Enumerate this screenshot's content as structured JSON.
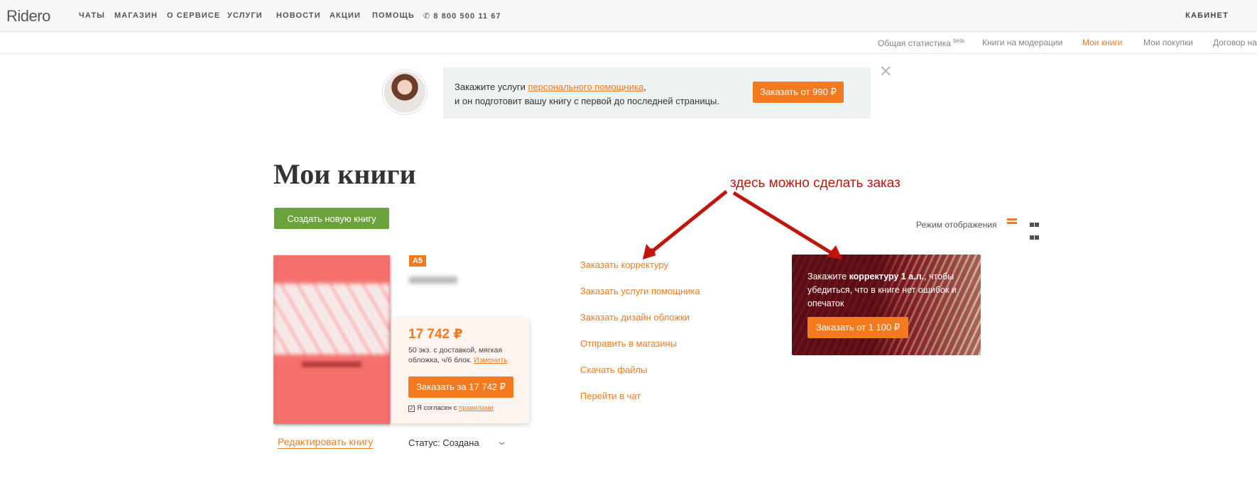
{
  "header": {
    "logo": "Ridero",
    "nav": [
      "ЧАТЫ",
      "МАГАЗИН",
      "О СЕРВИСЕ",
      "УСЛУГИ",
      "НОВОСТИ",
      "АКЦИИ",
      "ПОМОЩЬ"
    ],
    "phone": "8 800 500 11 67",
    "cabinet": "КАБИНЕТ"
  },
  "subnav": {
    "items": [
      {
        "label": "Общая статистика",
        "sup": "beta"
      },
      {
        "label": "Книги на модерации"
      },
      {
        "label": "Мои книги",
        "active": true
      },
      {
        "label": "Мои покупки"
      },
      {
        "label": "Договор на"
      }
    ]
  },
  "promo": {
    "text_before": "Закажите услуги ",
    "link": "персонального помощника",
    "text_after": ",",
    "line2": "и он подготовит вашу книгу с первой до последней страницы.",
    "button": "Заказать от 990 ₽"
  },
  "page": {
    "title": "Мои книги",
    "annotation": "здесь можно сделать заказ",
    "create_button": "Создать новую книгу",
    "view_mode_label": "Режим отображения"
  },
  "book": {
    "format": "A5",
    "price": "17 742 ₽",
    "desc": "50 экз. с доставкой, мягкая обложка, ч/б блок.",
    "change_link": "Изменить",
    "order_button": "Заказать за 17 742 ₽",
    "agree_text": "Я согласен с",
    "agree_link": "правилами",
    "edit_link": "Редактировать книгу",
    "status": "Статус: Создана"
  },
  "actions": [
    "Заказать корректуру",
    "Заказать услуги помощника",
    "Заказать дизайн обложки",
    "Отправить в магазины",
    "Скачать файлы",
    "Перейти в чат"
  ],
  "ad": {
    "text_before": "Закажите ",
    "bold": "корректуру 1 а.л.",
    "text_after": ", чтобы убедиться, что в книге нет ошибок и опечаток",
    "button": "Заказать от 1 100 ₽"
  },
  "colors": {
    "accent": "#f47a20",
    "green": "#6aa23b",
    "annotation": "#c0150b"
  }
}
